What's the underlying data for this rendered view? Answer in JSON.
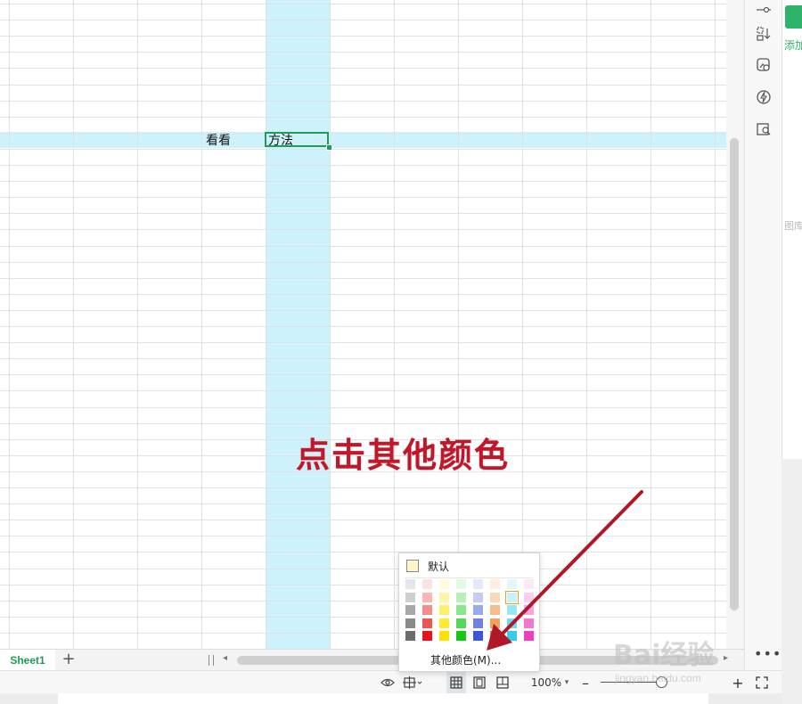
{
  "cells": {
    "c1_text": "看看",
    "c2_text": "方法"
  },
  "right_panel": {
    "add_label": "添加",
    "faded_label": "图库",
    "icons": [
      "settings-slider-icon",
      "sort-icon",
      "image-edit-icon",
      "lightning-icon",
      "book-search-icon"
    ]
  },
  "sheet_tabs": {
    "active": "Sheet1",
    "add": "+"
  },
  "status": {
    "zoom": "100%",
    "zoom_caret": "▾",
    "minus": "–",
    "plus": "+"
  },
  "color_popup": {
    "default_label": "默认",
    "more_label": "其他颜色(M)...",
    "palette_columns": [
      [
        "#e6e6e6",
        "#cfcfcf",
        "#a8a8a8",
        "#8a8a8a",
        "#6b6b6b"
      ],
      [
        "#fde2e2",
        "#fbb7b7",
        "#f58b8b",
        "#ef5454",
        "#e8141c"
      ],
      [
        "#fffbdc",
        "#fff4a8",
        "#fff06a",
        "#ffea2e",
        "#ffe100"
      ],
      [
        "#e1fae1",
        "#b6f2b6",
        "#8ce68c",
        "#55d855",
        "#14c814"
      ],
      [
        "#e4e8fb",
        "#c5cdf6",
        "#9aa8ee",
        "#6f82e6",
        "#3b56dc"
      ],
      [
        "#fdeee1",
        "#fbd7b8",
        "#f7bb8c",
        "#f39f5f",
        "#ee7a1e"
      ],
      [
        "#e0f7fb",
        "#c7f0f8",
        "#9be6f3",
        "#6ddaee",
        "#33ccea"
      ],
      [
        "#fde8f7",
        "#fbcdee",
        "#f7a4e0",
        "#f376d1",
        "#ee3fc2"
      ]
    ],
    "selected": [
      6,
      1
    ]
  },
  "annotation": "点击其他颜色",
  "watermark": "Bai经验",
  "watermark_sub": "jingyan.baidu.com",
  "accent_color": "#1f9d55",
  "highlight_color": "#cdf2fb",
  "annotation_color": "#c0182a"
}
